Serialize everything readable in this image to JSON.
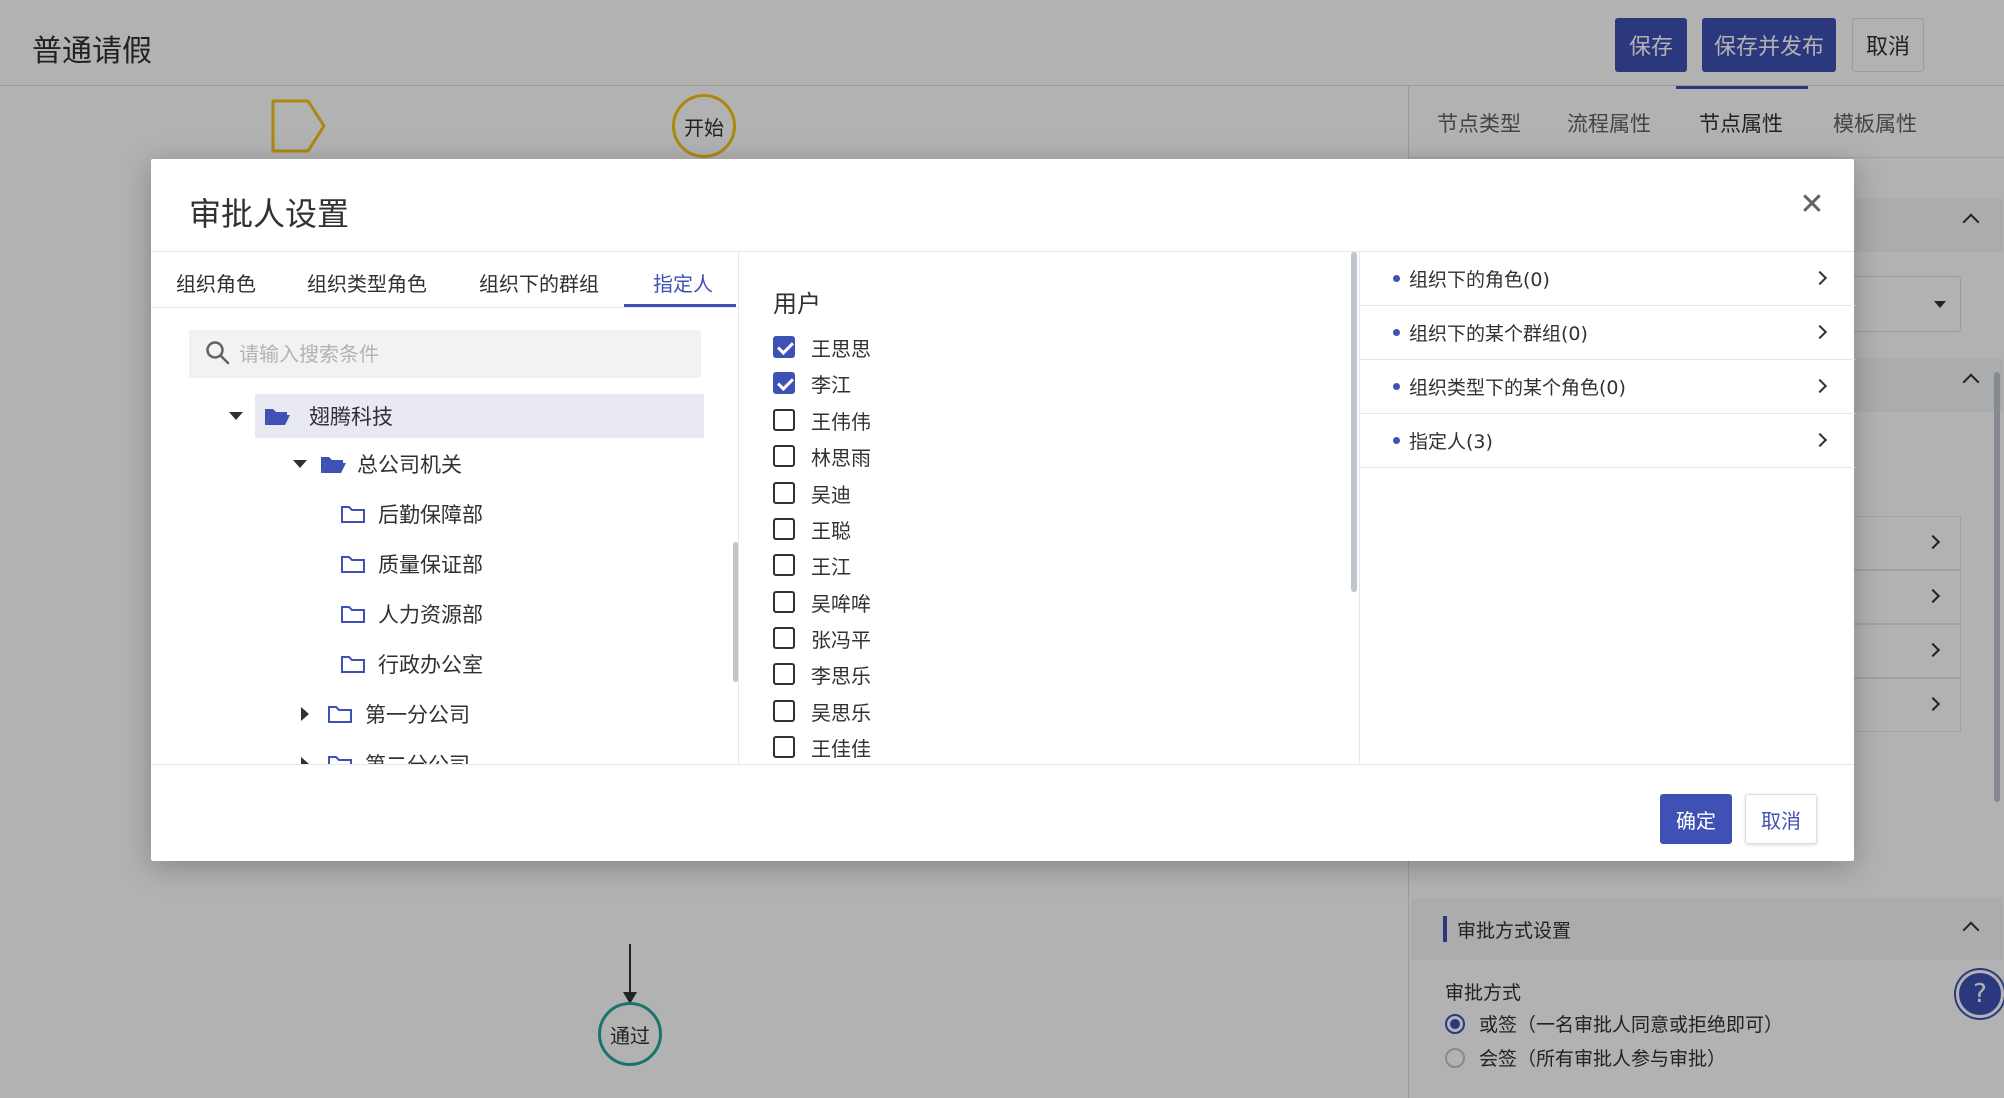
{
  "header": {
    "title": "普通请假",
    "save_label": "保存",
    "save_publish_label": "保存并发布",
    "cancel_label": "取消"
  },
  "canvas": {
    "start_label": "开始",
    "pass_label": "通过"
  },
  "right_panel": {
    "tabs": [
      "节点类型",
      "流程属性",
      "节点属性",
      "模板属性"
    ],
    "active_tab": "节点属性",
    "approval_section_title": "审批方式设置",
    "approval_label": "审批方式",
    "approval_options": [
      {
        "label": "或签（一名审批人同意或拒绝即可）",
        "selected": true
      },
      {
        "label": "会签（所有审批人参与审批）",
        "selected": false
      }
    ],
    "help_glyph": "?"
  },
  "dialog": {
    "title": "审批人设置",
    "close_glyph": "✕",
    "tabs": [
      "组织角色",
      "组织类型角色",
      "组织下的群组",
      "指定人"
    ],
    "active_tab": "指定人",
    "search_placeholder": "请输入搜索条件",
    "tree": [
      {
        "label": "翅腾科技",
        "level": 0,
        "expanded": true,
        "selected": true
      },
      {
        "label": "总公司机关",
        "level": 1,
        "expanded": true
      },
      {
        "label": "后勤保障部",
        "level": 2
      },
      {
        "label": "质量保证部",
        "level": 2
      },
      {
        "label": "人力资源部",
        "level": 2
      },
      {
        "label": "行政办公室",
        "level": 2
      },
      {
        "label": "第一分公司",
        "level": 1,
        "expanded": false
      },
      {
        "label": "第二分公司",
        "level": 1,
        "expanded": false
      }
    ],
    "users_title": "用户",
    "users": [
      {
        "name": "王思思",
        "checked": true
      },
      {
        "name": "李江",
        "checked": true
      },
      {
        "name": "王伟伟",
        "checked": false
      },
      {
        "name": "林思雨",
        "checked": false
      },
      {
        "name": "吴迪",
        "checked": false
      },
      {
        "name": "王聪",
        "checked": false
      },
      {
        "name": "王江",
        "checked": false
      },
      {
        "name": "吴哞哞",
        "checked": false
      },
      {
        "name": "张冯平",
        "checked": false
      },
      {
        "name": "李思乐",
        "checked": false
      },
      {
        "name": "吴思乐",
        "checked": false
      },
      {
        "name": "王佳佳",
        "checked": false
      }
    ],
    "summary": [
      {
        "label": "组织下的角色(0)"
      },
      {
        "label": "组织下的某个群组(0)"
      },
      {
        "label": "组织类型下的某个角色(0)"
      },
      {
        "label": "指定人(3)"
      }
    ],
    "ok_label": "确定",
    "cancel_label": "取消"
  },
  "colors": {
    "accent": "#3f51b5",
    "start_node": "#f5c518",
    "pass_node": "#26a69a"
  }
}
